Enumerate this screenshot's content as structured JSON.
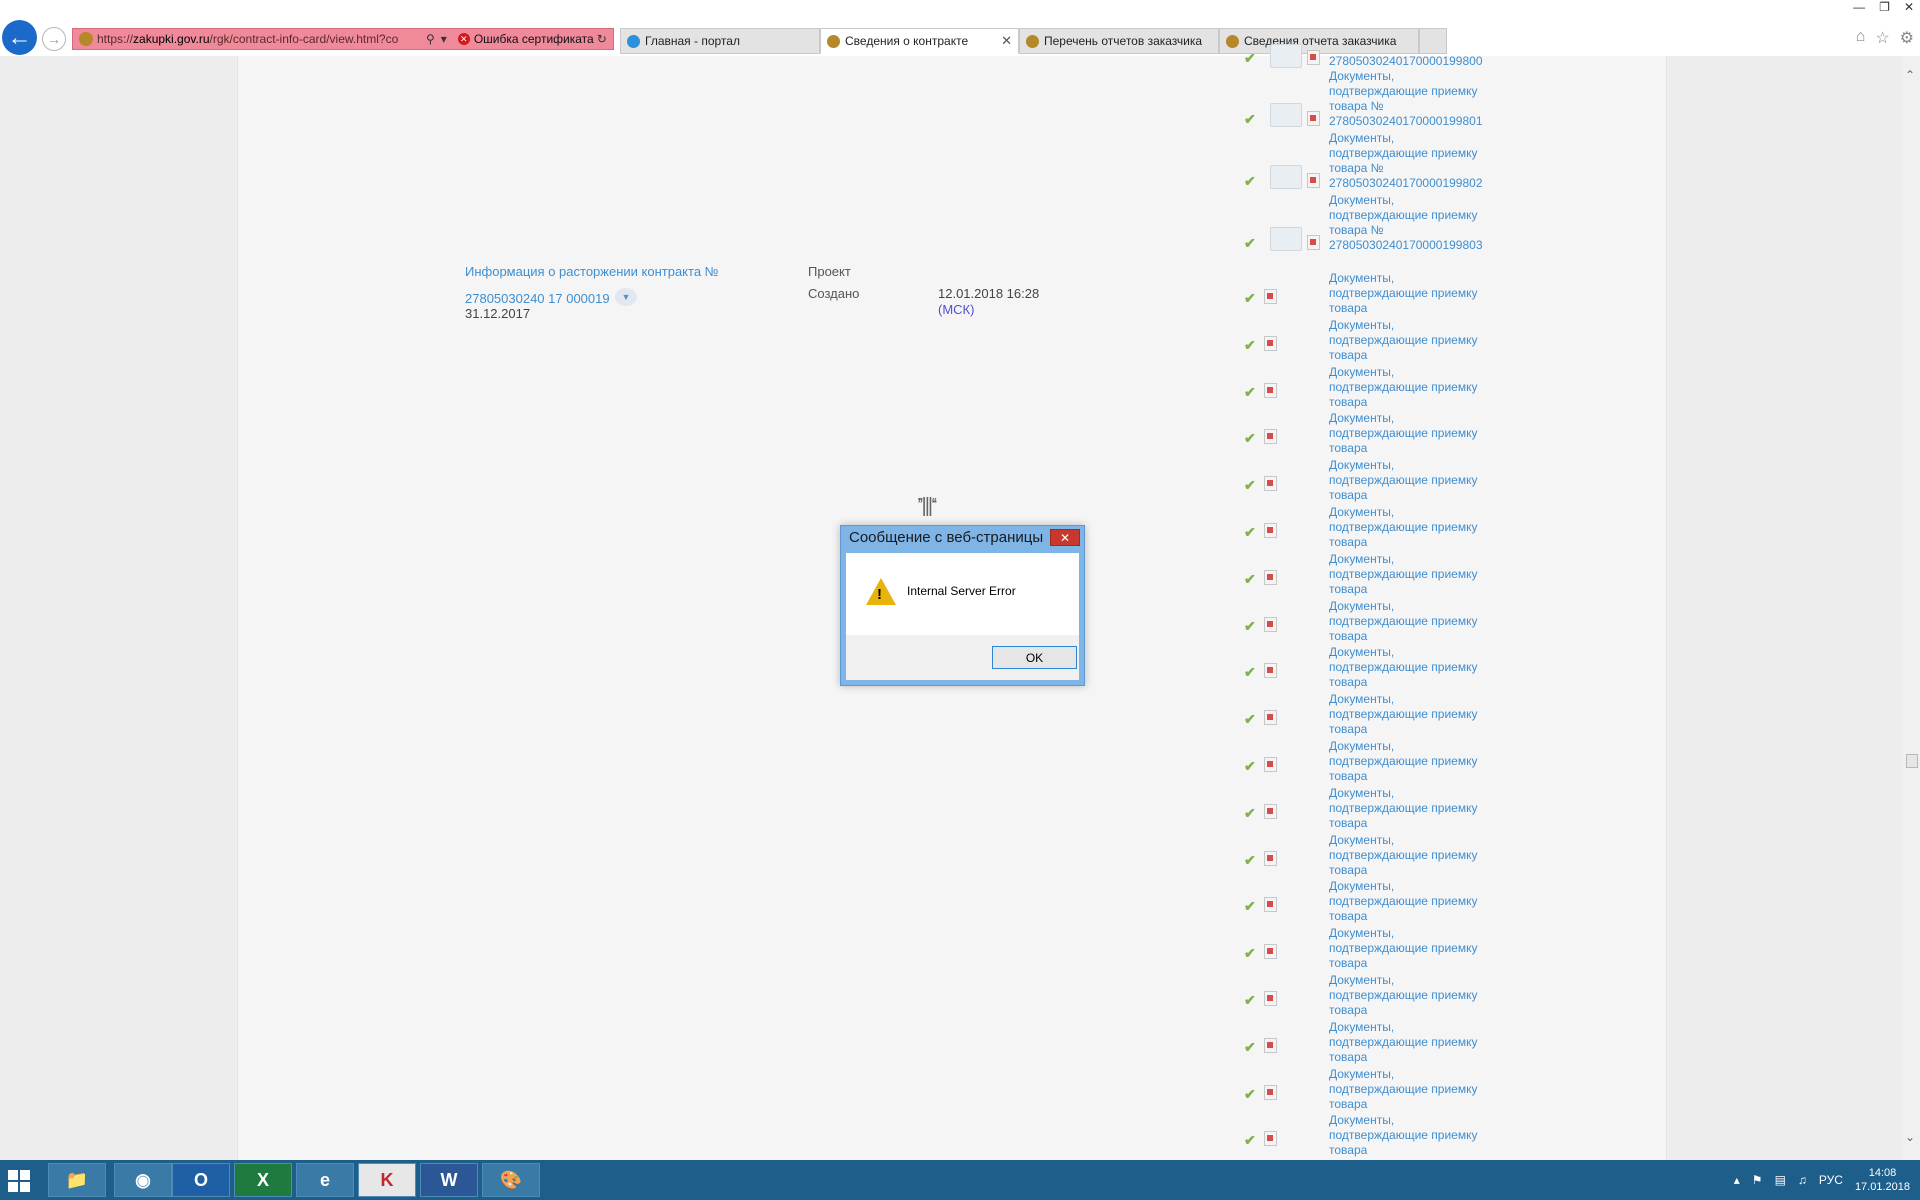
{
  "browser": {
    "url_prefix": "https://",
    "url_domain": "zakupki.gov.ru",
    "url_path": "/rgk/contract-info-card/view.html?co",
    "cert_error": "Ошибка сертификата",
    "tabs": [
      {
        "label": "Главная - портал",
        "icon": "ie-icon"
      },
      {
        "label": "Сведения о контракте",
        "icon": "eagle-icon",
        "active": true
      },
      {
        "label": "Перечень отчетов заказчика",
        "icon": "eagle-icon"
      },
      {
        "label": "Сведения отчета заказчика",
        "icon": "eagle-icon"
      }
    ]
  },
  "termination": {
    "title": "Информация о расторжении контракта №",
    "number": "27805030240 17 000019",
    "date": "31.12.2017",
    "status": "Проект",
    "created_label": "Создано",
    "created_value": "12.01.2018 16:28",
    "timezone": "(МСК)"
  },
  "documents": {
    "top_partial_number": "2780503024017000019980​0",
    "numbered": [
      {
        "line1": "Документы,",
        "line2": "подтверждающие приемку",
        "line3": "товара №",
        "line4": "27805030240170000199801"
      },
      {
        "line1": "Документы,",
        "line2": "подтверждающие приемку",
        "line3": "товара №",
        "line4": "27805030240170000199802"
      },
      {
        "line1": "Документы,",
        "line2": "подтверждающие приемку",
        "line3": "товара №",
        "line4": "27805030240170000199803"
      }
    ],
    "plain_line1": "Документы,",
    "plain_line2": "подтверждающие приемку",
    "plain_line3": "товара",
    "plain_count": 19
  },
  "dialog": {
    "title": "Сообщение с веб-страницы",
    "message": "Internal Server Error",
    "ok_label": "OK"
  },
  "taskbar": {
    "apps": [
      "file-explorer",
      "chrome",
      "outlook",
      "excel",
      "internet-explorer",
      "kaspersky",
      "word",
      "paint"
    ],
    "language": "РУС",
    "time": "14:08",
    "date": "17.01.2018"
  }
}
